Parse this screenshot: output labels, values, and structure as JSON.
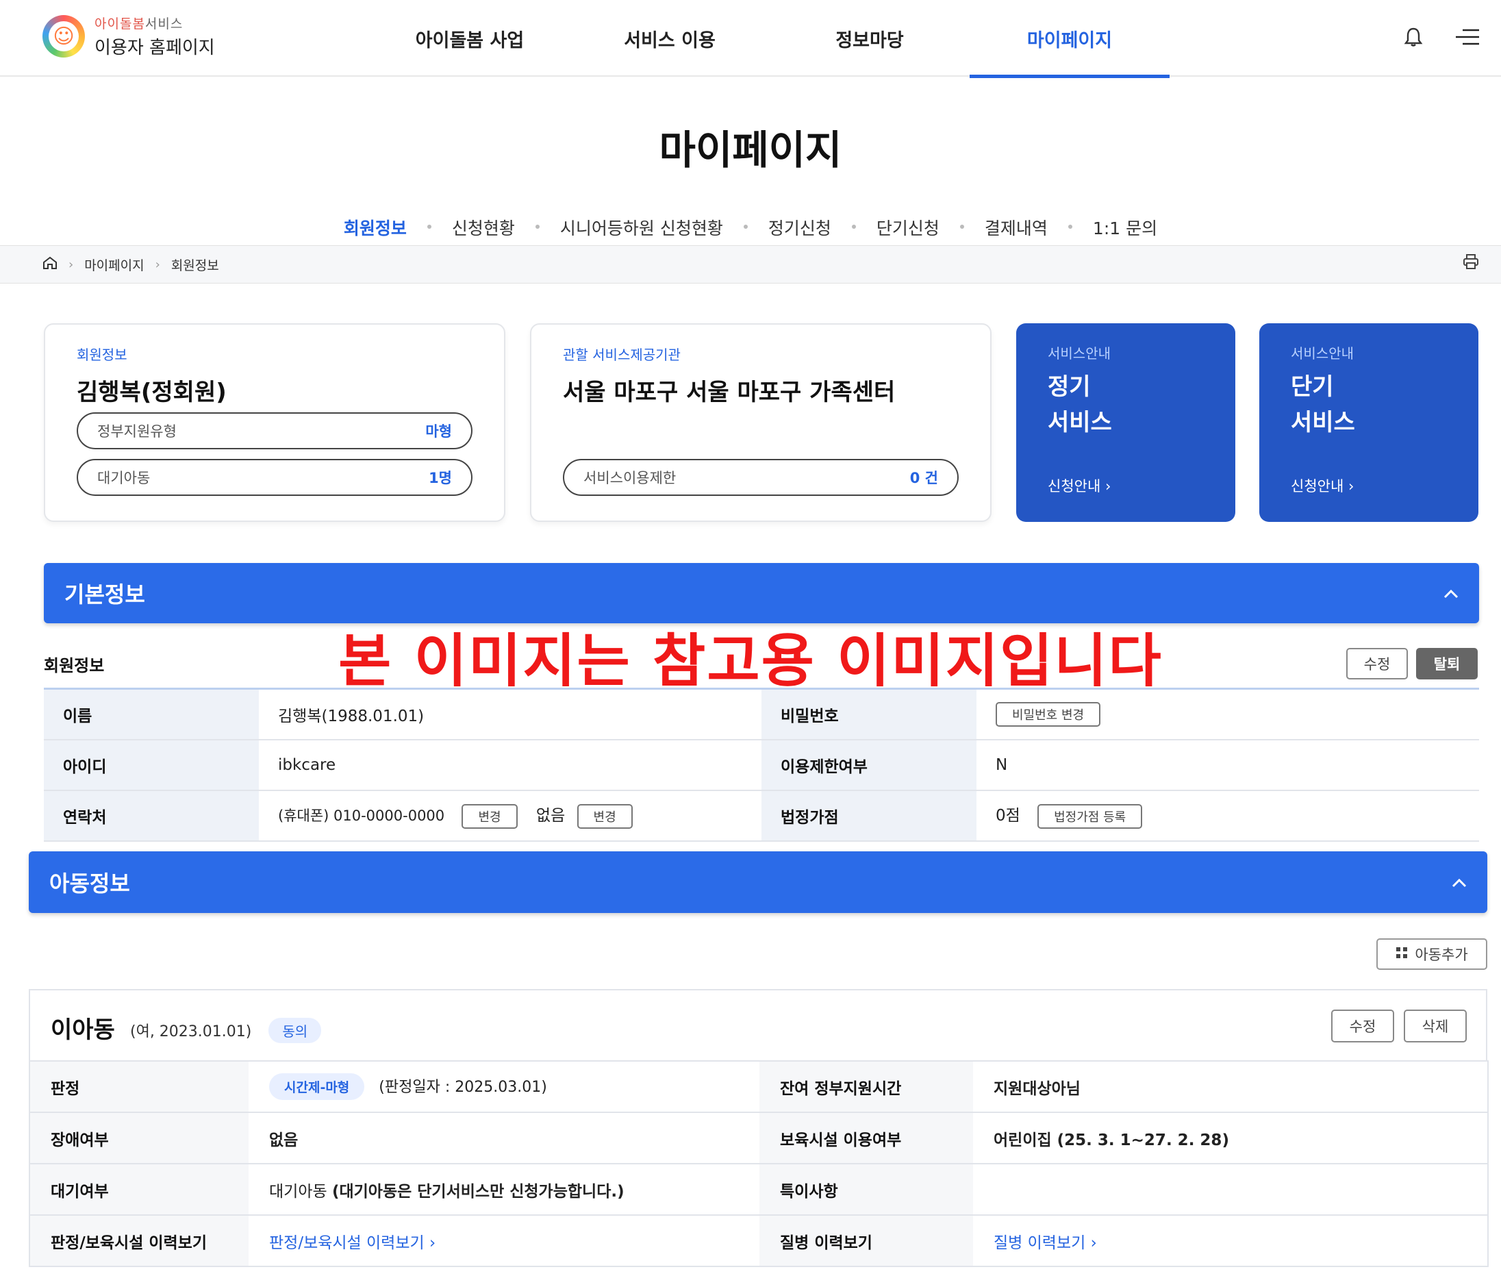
{
  "header": {
    "logo_sub_a": "아이돌봄",
    "logo_sub_b": "서비스",
    "logo_main": "이용자 홈페이지",
    "nav": [
      "아이돌봄 사업",
      "서비스 이용",
      "정보마당",
      "마이페이지"
    ],
    "active_nav": "마이페이지"
  },
  "page_title": "마이페이지",
  "subtabs": [
    "회원정보",
    "신청현황",
    "시니어등하원 신청현황",
    "정기신청",
    "단기신청",
    "결제내역",
    "1:1 문의"
  ],
  "breadcrumb": [
    "마이페이지",
    "회원정보"
  ],
  "cards": {
    "member": {
      "label": "회원정보",
      "title": "김행복(정회원)",
      "pill1_label": "정부지원유형",
      "pill1_value": "마형",
      "pill2_label": "대기아동",
      "pill2_value": "1명"
    },
    "center": {
      "label": "관할 서비스제공기관",
      "title": "서울 마포구 서울 마포구 가족센터",
      "pill_label": "서비스이용제한",
      "pill_value": "0 건"
    },
    "regular": {
      "label": "서비스안내",
      "title1": "정기",
      "title2": "서비스",
      "link": "신청안내 ›"
    },
    "short": {
      "label": "서비스안내",
      "title1": "단기",
      "title2": "서비스",
      "link": "신청안내 ›"
    }
  },
  "basic_section": {
    "title": "기본정보",
    "subhead": "회원정보",
    "edit_btn": "수정",
    "withdraw_btn": "탈퇴",
    "rows": {
      "name_label": "이름",
      "name_value": "김행복(1988.01.01)",
      "pw_label": "비밀번호",
      "pw_btn": "비밀번호 변경",
      "id_label": "아이디",
      "id_value": "ibkcare",
      "limit_label": "이용제한여부",
      "limit_value": "N",
      "contact_label": "연락처",
      "contact_value": "(휴대폰) 010-0000-0000",
      "contact_btn1": "변경",
      "contact_none": "없음",
      "contact_btn2": "변경",
      "penalty_label": "법정가점",
      "penalty_value": "0점",
      "penalty_btn": "법정가점 등록"
    }
  },
  "watermark": "본 이미지는 참고용 이미지입니다",
  "child_section": {
    "title": "아동정보",
    "add_btn": "아동추가",
    "child": {
      "name": "이아동",
      "info": "(여, 2023.01.01)",
      "badge": "동의",
      "edit_btn": "수정",
      "delete_btn": "삭제"
    },
    "rows": {
      "judge_label": "판정",
      "judge_tag": "시간제-마형",
      "judge_date": "(판정일자 : 2025.03.01)",
      "remain_label": "잔여 정부지원시간",
      "remain_value": "지원대상아님",
      "disab_label": "장애여부",
      "disab_value": "없음",
      "daycare_label": "보육시설 이용여부",
      "daycare_value": "어린이집 (25. 3. 1~27. 2. 28)",
      "wait_label": "대기여부",
      "wait_value_a": "대기아동",
      "wait_value_b": "(대기아동은 단기서비스만 신청가능합니다.)",
      "special_label": "특이사항",
      "special_value": "",
      "history_label": "판정/보육시설 이력보기",
      "history_link": "판정/보육시설 이력보기 ›",
      "disease_label": "질병 이력보기",
      "disease_link": "질병 이력보기 ›"
    }
  },
  "icons": [
    "bell-icon",
    "menu-icon",
    "home-icon",
    "print-icon",
    "chevron-up-icon",
    "grid-icon"
  ],
  "colors": {
    "accent": "#2463e0",
    "section_bar": "#2b6be8",
    "card_blue": "#2456c4",
    "watermark": "#f01919"
  }
}
